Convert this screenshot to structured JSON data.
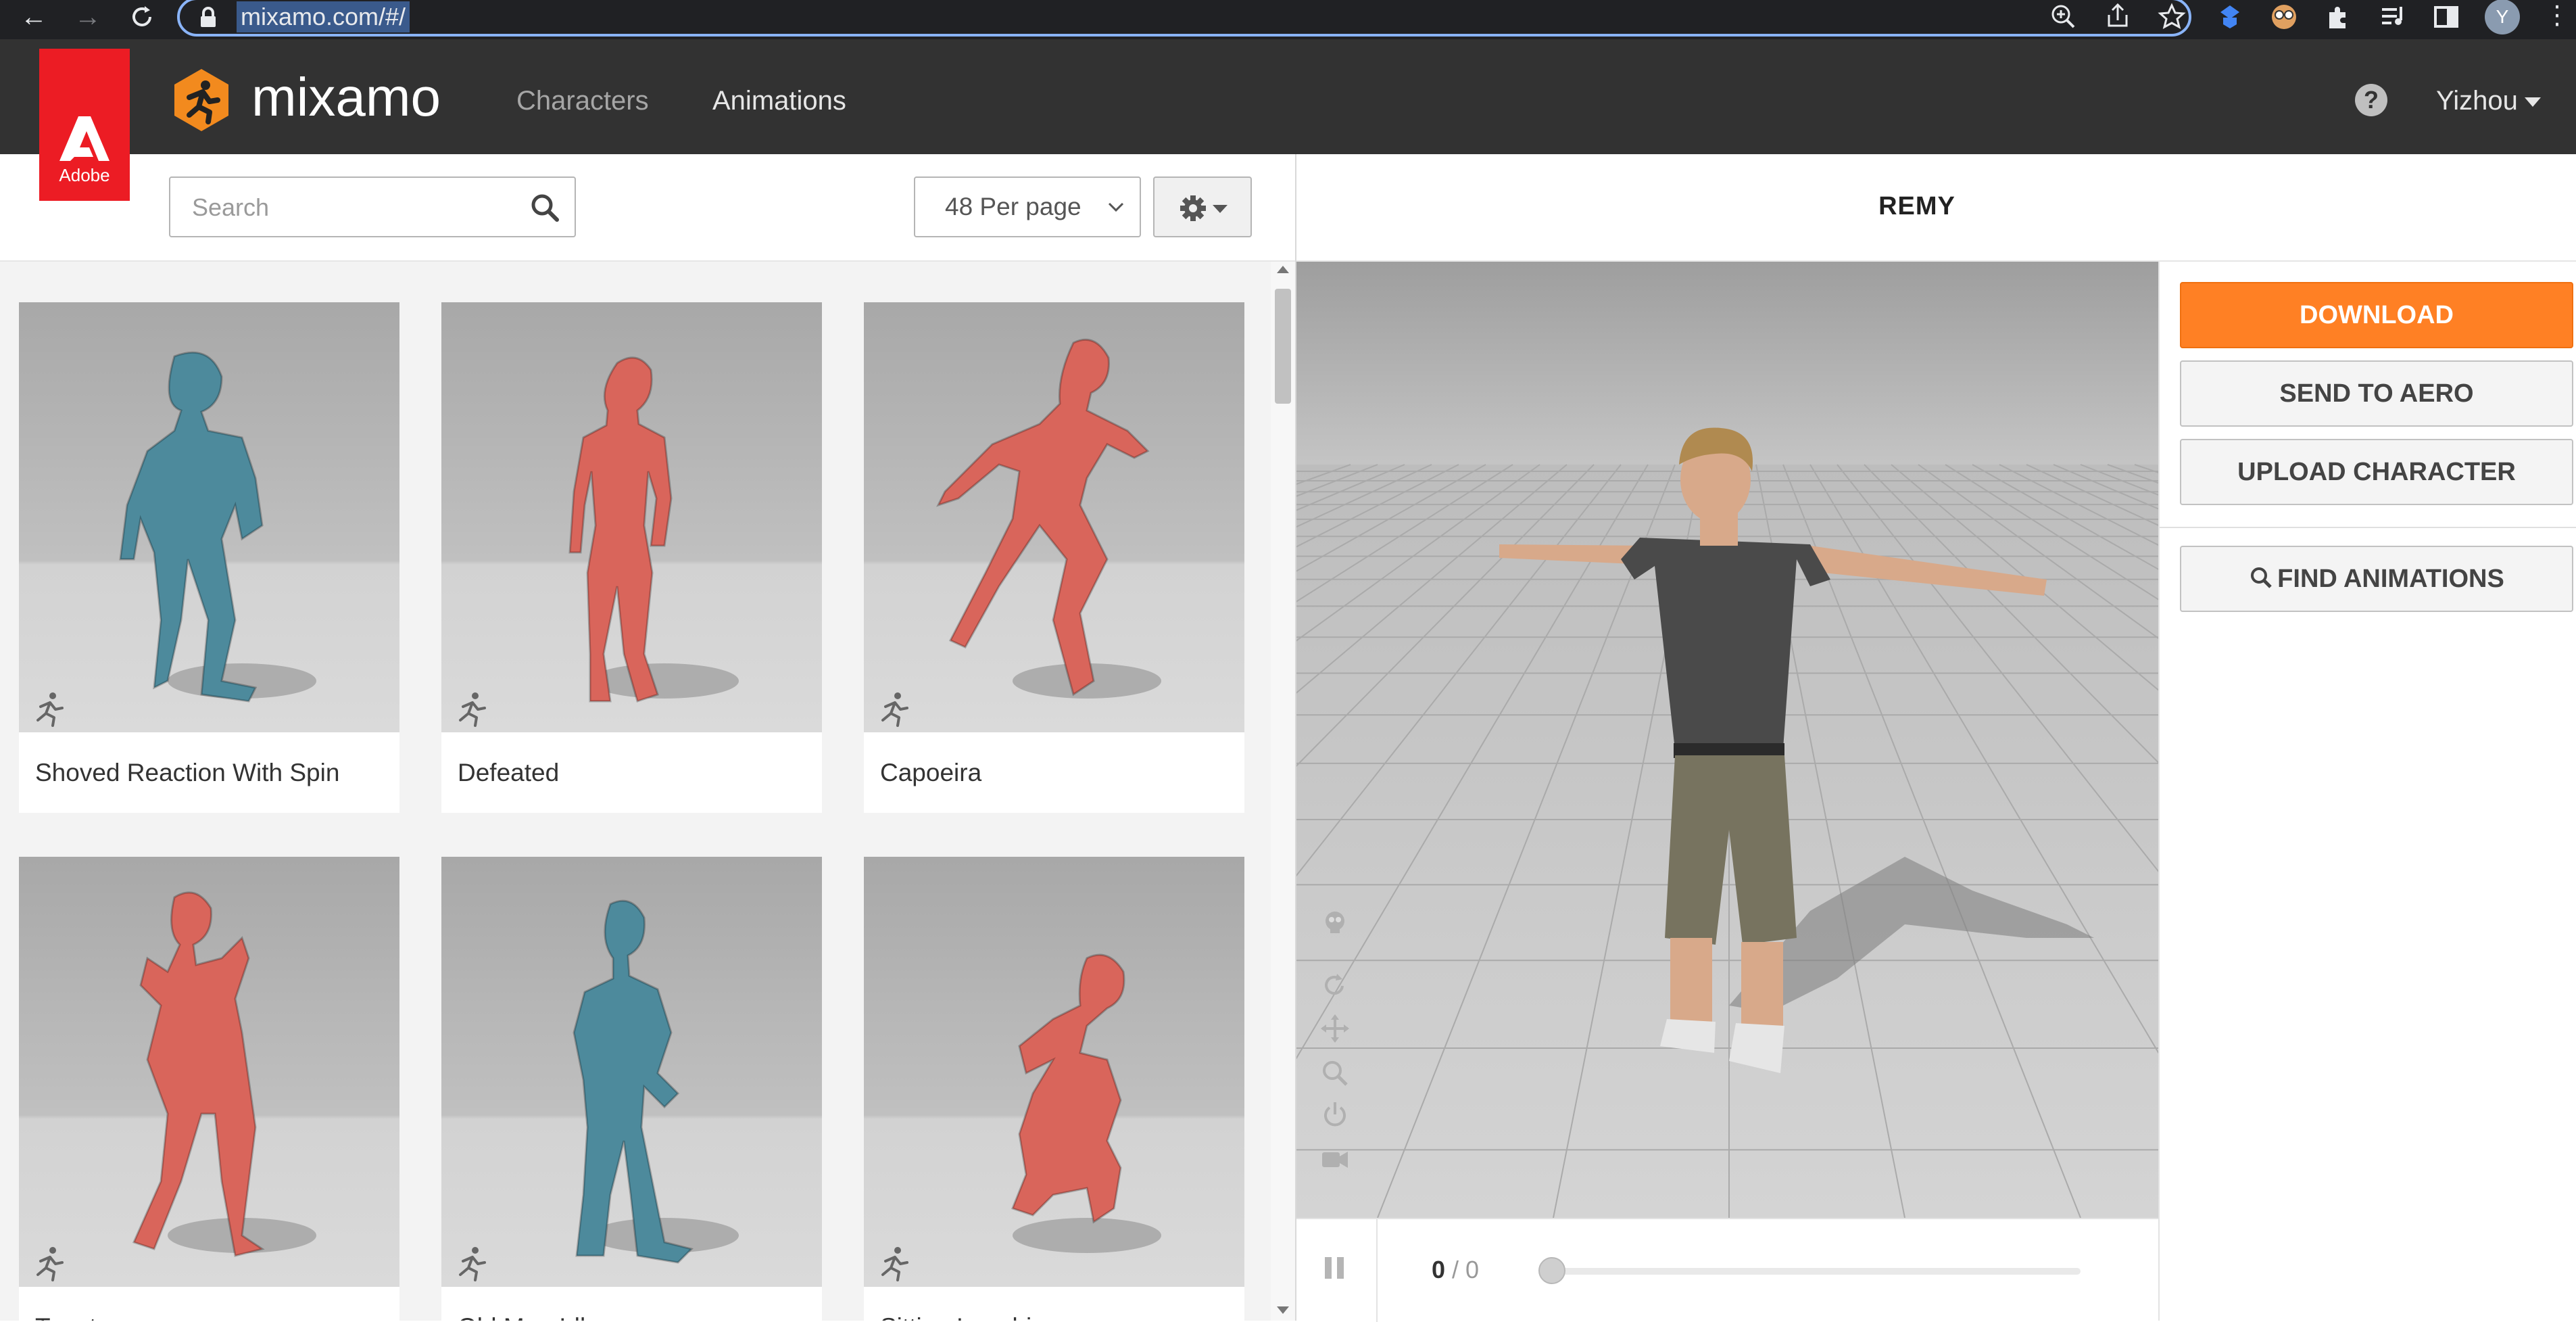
{
  "browser": {
    "url": "mixamo.com/#/",
    "profile_initial": "Y"
  },
  "header": {
    "adobe_label": "Adobe",
    "logo_text": "mixamo",
    "nav": {
      "characters": "Characters",
      "animations": "Animations"
    },
    "help_label": "?",
    "user_name": "Yizhou"
  },
  "library": {
    "search_placeholder": "Search",
    "per_page_label": "48 Per page",
    "cards": [
      {
        "name": "Shoved Reaction With Spin",
        "color": "#4d8a9c"
      },
      {
        "name": "Defeated",
        "color": "#d9655b"
      },
      {
        "name": "Capoeira",
        "color": "#d9655b"
      },
      {
        "name": "Taunt",
        "color": "#d9655b"
      },
      {
        "name": "Old Man Idle",
        "color": "#4d8a9c"
      },
      {
        "name": "Sitting Laughing",
        "color": "#d9655b"
      }
    ]
  },
  "viewer": {
    "character_name": "REMY",
    "frame_current": "0",
    "frame_total": "/ 0"
  },
  "actions": {
    "download": "DOWNLOAD",
    "send_to_aero": "SEND TO AERO",
    "upload_character": "UPLOAD CHARACTER",
    "find_animations": "FIND ANIMATIONS"
  },
  "colors": {
    "accent": "#ff8024",
    "header_bg": "#323232",
    "adobe_red": "#ec1c24",
    "robot_red": "#d9655b",
    "robot_blue": "#4d8a9c"
  }
}
